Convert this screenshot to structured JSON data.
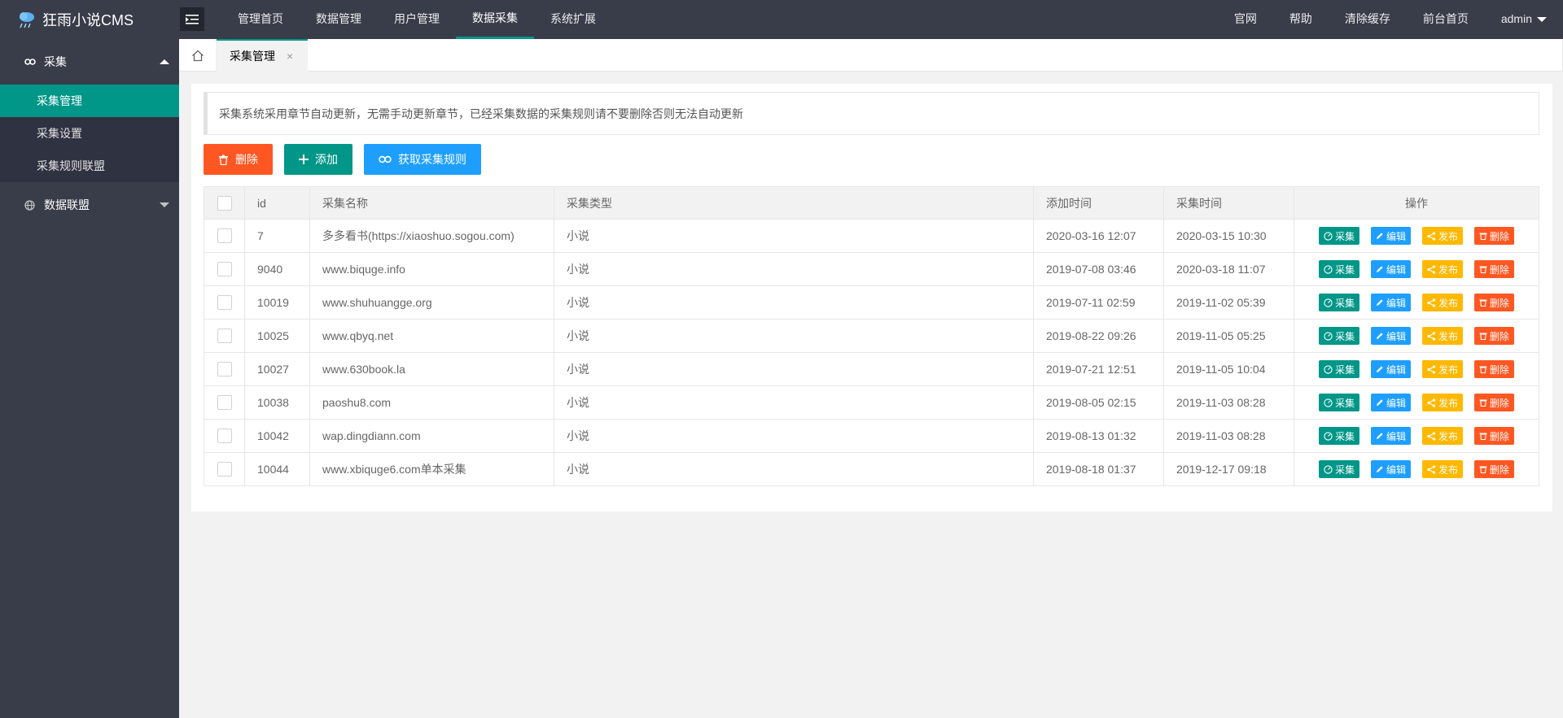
{
  "app": {
    "title": "狂雨小说CMS"
  },
  "topnav": {
    "items": [
      "管理首页",
      "数据管理",
      "用户管理",
      "数据采集",
      "系统扩展"
    ],
    "active_index": 3
  },
  "rightnav": {
    "items": [
      "官网",
      "帮助",
      "清除缓存",
      "前台首页"
    ],
    "user": "admin"
  },
  "sidebar": {
    "group1": {
      "label": "采集",
      "items": [
        "采集管理",
        "采集设置",
        "采集规则联盟"
      ],
      "active_index": 0
    },
    "group2": {
      "label": "数据联盟"
    }
  },
  "tabs": {
    "current": "采集管理",
    "close": "×"
  },
  "notice": "采集系统采用章节自动更新，无需手动更新章节，已经采集数据的采集规则请不要删除否则无法自动更新",
  "toolbar": {
    "delete": "删除",
    "add": "添加",
    "fetch_rules": "获取采集规则"
  },
  "table": {
    "headers": {
      "id": "id",
      "name": "采集名称",
      "type": "采集类型",
      "added": "添加时间",
      "collected": "采集时间",
      "ops": "操作"
    },
    "actions": {
      "collect": "采集",
      "edit": "编辑",
      "publish": "发布",
      "delete": "删除"
    },
    "rows": [
      {
        "id": "7",
        "name": "多多看书(https://xiaoshuo.sogou.com)",
        "type": "小说",
        "added": "2020-03-16 12:07",
        "collected": "2020-03-15 10:30"
      },
      {
        "id": "9040",
        "name": "www.biquge.info",
        "type": "小说",
        "added": "2019-07-08 03:46",
        "collected": "2020-03-18 11:07"
      },
      {
        "id": "10019",
        "name": "www.shuhuangge.org",
        "type": "小说",
        "added": "2019-07-11 02:59",
        "collected": "2019-11-02 05:39"
      },
      {
        "id": "10025",
        "name": "www.qbyq.net",
        "type": "小说",
        "added": "2019-08-22 09:26",
        "collected": "2019-11-05 05:25"
      },
      {
        "id": "10027",
        "name": "www.630book.la",
        "type": "小说",
        "added": "2019-07-21 12:51",
        "collected": "2019-11-05 10:04"
      },
      {
        "id": "10038",
        "name": "paoshu8.com",
        "type": "小说",
        "added": "2019-08-05 02:15",
        "collected": "2019-11-03 08:28"
      },
      {
        "id": "10042",
        "name": "wap.dingdiann.com",
        "type": "小说",
        "added": "2019-08-13 01:32",
        "collected": "2019-11-03 08:28"
      },
      {
        "id": "10044",
        "name": "www.xbiquge6.com单本采集",
        "type": "小说",
        "added": "2019-08-18 01:37",
        "collected": "2019-12-17 09:18"
      }
    ]
  },
  "colors": {
    "header_bg": "#393d49",
    "accent": "#009688",
    "danger": "#ff5722",
    "info": "#1e9fff",
    "warn": "#ffb800"
  }
}
